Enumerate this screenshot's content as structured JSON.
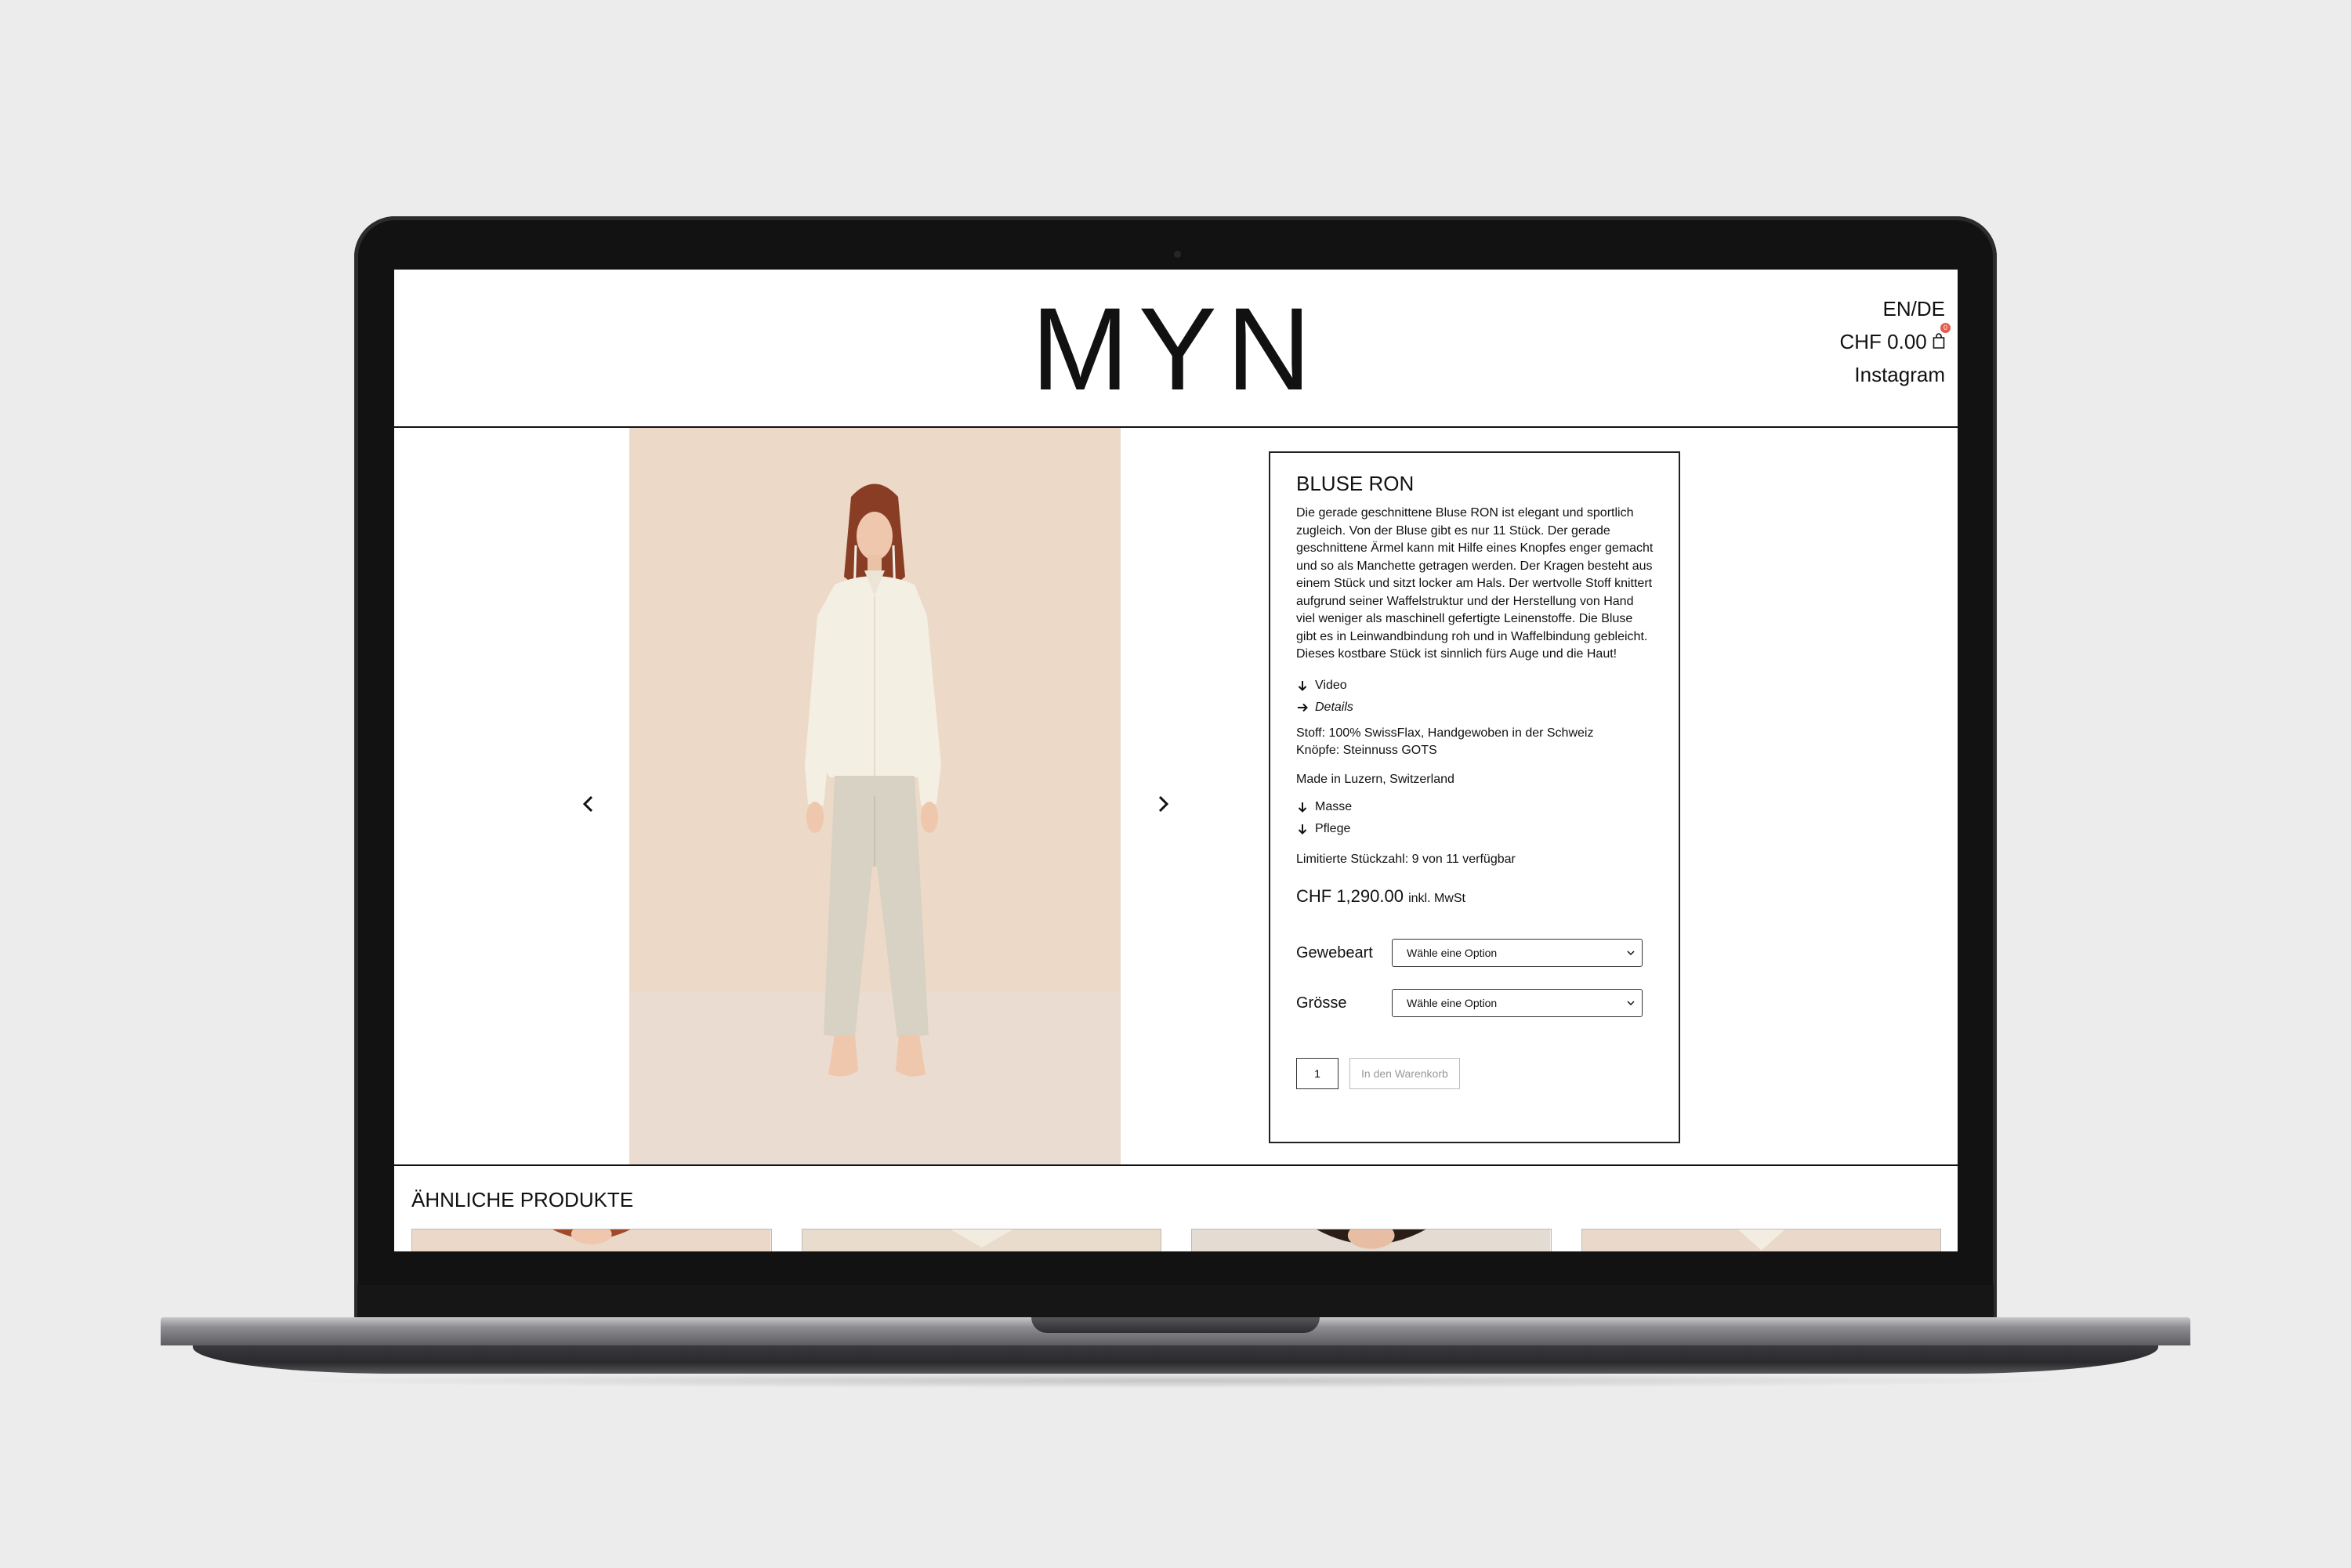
{
  "site": {
    "logo": "MYN",
    "lang_switch": "EN/DE",
    "cart_total": "CHF 0.00",
    "cart_count": "0",
    "instagram": "Instagram"
  },
  "product": {
    "title": "BLUSE RON",
    "description": "Die gerade geschnittene Bluse RON ist elegant und sportlich zugleich. Von der Bluse gibt es nur 11 Stück. Der gerade geschnittene Ärmel kann mit Hilfe eines Knopfes enger gemacht und so als Manchette getragen werden. Der Kragen besteht aus einem Stück und sitzt locker am Hals. Der wertvolle Stoff knittert aufgrund seiner Waffelstruktur und der Herstellung von Hand viel weniger als maschinell gefertigte Leinenstoffe. Die Bluse gibt es in Leinwandbindung roh und in Waffelbindung gebleicht. Dieses kostbare Stück ist sinnlich fürs Auge und die Haut!",
    "toggle_video": "Video",
    "toggle_details": "Details",
    "fabric": "Stoff: 100% SwissFlax, Handgewoben in der Schweiz",
    "buttons_material": "Knöpfe: Steinnuss GOTS",
    "made_in": "Made in Luzern, Switzerland",
    "toggle_masse": "Masse",
    "toggle_pflege": "Pflege",
    "stock": "Limitierte Stückzahl: 9 von 11 verfügbar",
    "price": "CHF 1,290.00",
    "price_tax": "inkl. MwSt",
    "option1_label": "Gewebeart",
    "option1_value": "Wähle eine Option",
    "option2_label": "Grösse",
    "option2_value": "Wähle eine Option",
    "quantity": "1",
    "add_to_cart": "In den Warenkorb"
  },
  "related": {
    "title": "ÄHNLICHE PRODUKTE"
  },
  "icons": {
    "prev": "chevron-left-icon",
    "next": "chevron-right-icon",
    "cart": "shopping-bag-icon",
    "collapsed": "arrow-down-icon",
    "expanded": "arrow-right-icon"
  }
}
